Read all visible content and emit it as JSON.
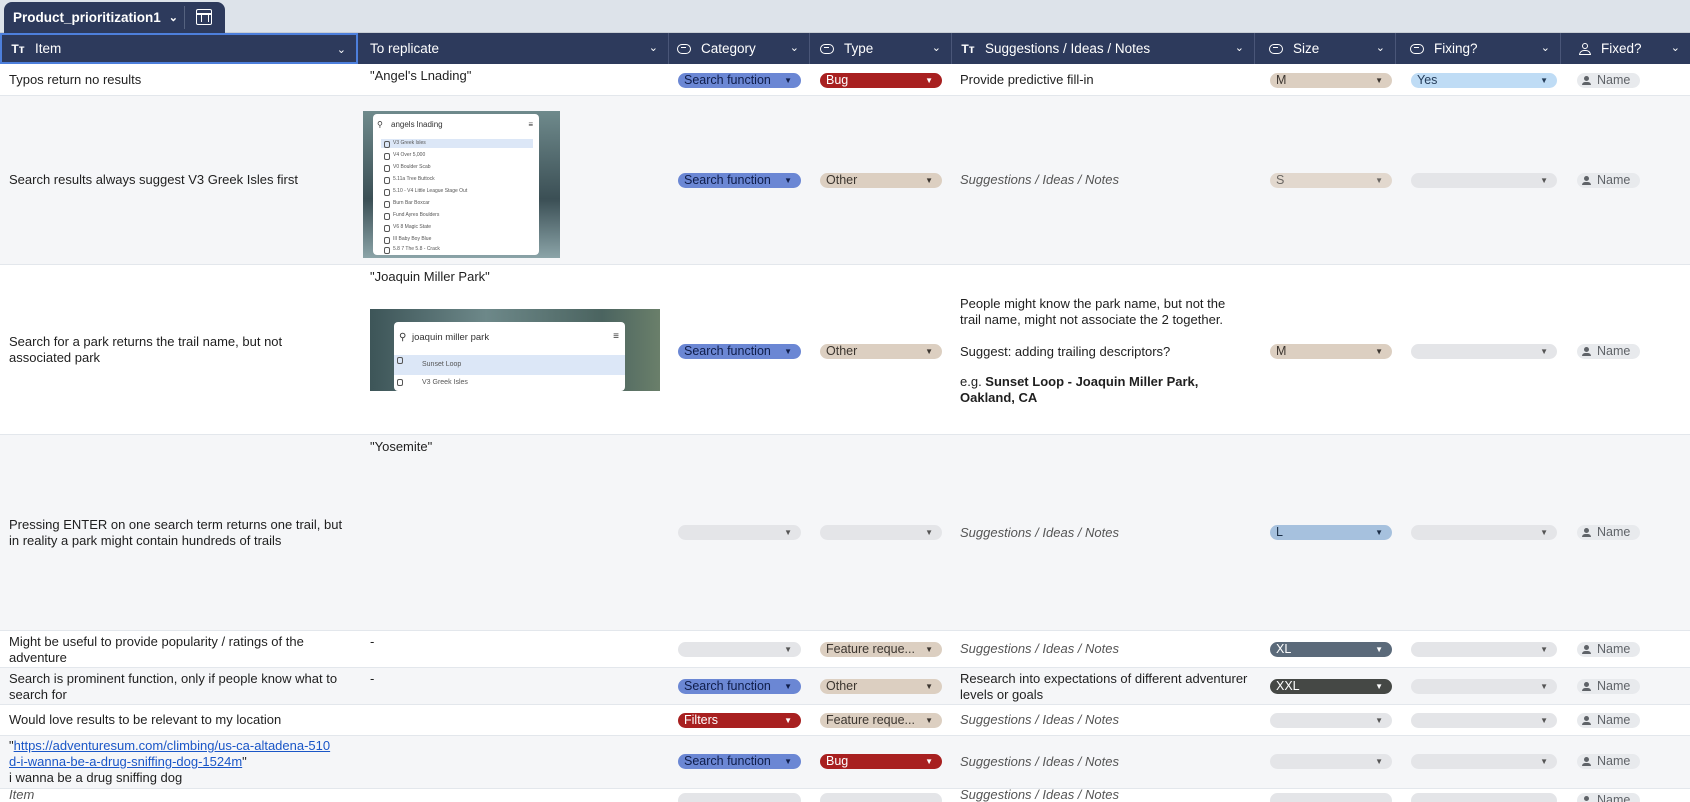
{
  "tab": {
    "name": "Product_prioritization1"
  },
  "columns": {
    "item": "Item",
    "to_replicate": "To replicate",
    "category": "Category",
    "type": "Type",
    "notes": "Suggestions / Ideas / Notes",
    "size": "Size",
    "fixing": "Fixing?",
    "fixed": "Fixed?"
  },
  "icons": {
    "text": "text-type-icon",
    "dropdown": "dropdown-pill-icon",
    "person": "person-icon",
    "table": "table-icon"
  },
  "placeholder": {
    "notes": "Suggestions / Ideas / Notes",
    "person": "Name",
    "item": "Item"
  },
  "rows": [
    {
      "item": "Typos return no results",
      "replicate": "\"Angel's Lnading\"",
      "category": "Search function",
      "type": "Bug",
      "notes": "Provide predictive fill-in",
      "size": "M",
      "fixing": "Yes",
      "fixed": "Name"
    },
    {
      "item": "Search results always suggest V3 Greek Isles first",
      "category": "Search function",
      "type": "Other",
      "notes": "Suggestions / Ideas / Notes",
      "size": "S",
      "fixing": "",
      "fixed": "Name",
      "screenshot": {
        "query": "angels lnading",
        "results": [
          "V3 Greek Isles",
          "V4 Over 5,000",
          "V0 Boulder Scab",
          "5.11a Tree Buttock",
          "5.10 - V4 Little League Stage Out",
          "Burn Bar Boxcar",
          "Fund Ayres Boulders",
          "V6 8 Magic State",
          "III Baby Boy Blue",
          "5.8 7 The 5.8 - Crack"
        ]
      }
    },
    {
      "item": "Search for a park returns the trail name, but not associated park",
      "replicate": "\"Joaquin Miller Park\"",
      "category": "Search function",
      "type": "Other",
      "notes_lines": [
        "People might know the park name, but not the trail name, might not associate the 2 together.",
        "Suggest: adding trailing descriptors?",
        "e.g. ",
        "Sunset Loop - Joaquin Miller Park, Oakland, CA"
      ],
      "size": "M",
      "fixing": "",
      "fixed": "Name",
      "screenshot": {
        "query": "joaquin miller park",
        "results": [
          "Sunset Loop",
          "V3 Greek Isles"
        ]
      }
    },
    {
      "item": "Pressing ENTER on one search term returns one trail, but in reality a park might contain hundreds of trails",
      "replicate": "\"Yosemite\"",
      "category": "",
      "type": "",
      "notes": "Suggestions / Ideas / Notes",
      "size": "L",
      "fixing": "",
      "fixed": "Name"
    },
    {
      "item": "Might be useful to provide popularity / ratings of the adventure",
      "replicate": "-",
      "category": "",
      "type": "Feature reque...",
      "notes": "Suggestions / Ideas / Notes",
      "size": "XL",
      "fixing": "",
      "fixed": "Name"
    },
    {
      "item": "Search is prominent function, only if people know what to search for",
      "replicate": "-",
      "category": "Search function",
      "type": "Other",
      "notes": "Research into expectations of different adventurer levels or goals",
      "size": "XXL",
      "fixing": "",
      "fixed": "Name"
    },
    {
      "item": "Would love results to be relevant to my location",
      "replicate": "",
      "category": "Filters",
      "type": "Feature reque...",
      "notes": "Suggestions / Ideas / Notes",
      "size": "",
      "fixing": "",
      "fixed": "Name"
    },
    {
      "item_link": "https://adventuresum.com/climbing/us-ca-altadena-510d-i-wanna-be-a-drug-sniffing-dog-1524m",
      "item_link_line1": "https://adventuresum.com/climbing/us-ca-altadena-510",
      "item_link_line2": "d-i-wanna-be-a-drug-sniffing-dog-1524m",
      "item_sub": "i wanna be a drug sniffing dog",
      "replicate": "",
      "category": "Search function",
      "type": "Bug",
      "notes": "Suggestions / Ideas / Notes",
      "size": "",
      "fixing": "",
      "fixed": "Name"
    },
    {
      "item": "Item",
      "category": "",
      "type": "",
      "notes": "Suggestions / Ideas / Notes",
      "size": "",
      "fixing": "",
      "fixed": "Name"
    }
  ],
  "colors": {
    "header": "#2d3a5c",
    "search_function": "#6b87d4",
    "bug": "#a82020",
    "other": "#dccfc1",
    "yes": "#bfdcf5",
    "size_L": "#a6c1de",
    "size_XL": "#5b6a7a",
    "size_XXL": "#454845",
    "link": "#1a56c7"
  }
}
